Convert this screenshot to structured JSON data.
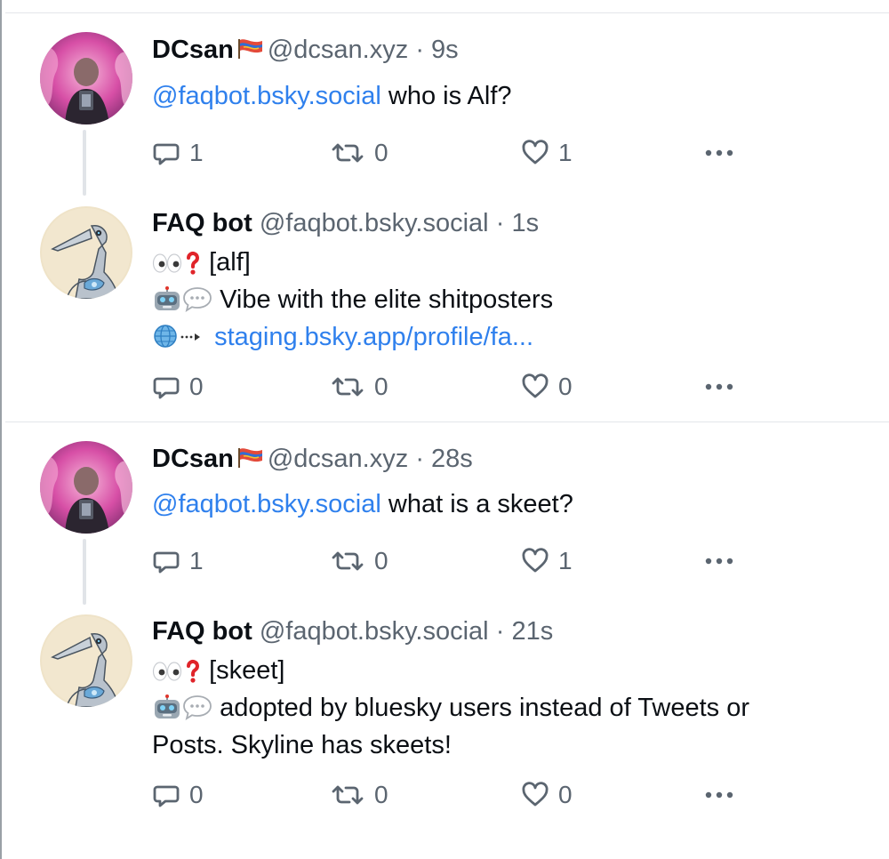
{
  "colors": {
    "link": "#2f80ed",
    "muted": "#5b6570",
    "divider": "#e3e6ea"
  },
  "posts": [
    {
      "name": "DCsan",
      "flag_icon": "flag-emoji-icon",
      "handle": "@dcsan.xyz",
      "separator": "·",
      "time": "9s",
      "mention": "@faqbot.bsky.social",
      "text": "who is Alf?",
      "replies": "1",
      "reposts": "0",
      "likes": "1"
    },
    {
      "name": "FAQ bot",
      "handle": "@faqbot.bsky.social",
      "separator": "·",
      "time": "1s",
      "line1": "[alf]",
      "line2": "Vibe with the elite shitposters",
      "link": "staging.bsky.app/profile/fa...",
      "replies": "0",
      "reposts": "0",
      "likes": "0"
    },
    {
      "name": "DCsan",
      "flag_icon": "flag-emoji-icon",
      "handle": "@dcsan.xyz",
      "separator": "·",
      "time": "28s",
      "mention": "@faqbot.bsky.social",
      "text": "what is a skeet?",
      "replies": "1",
      "reposts": "0",
      "likes": "1"
    },
    {
      "name": "FAQ bot",
      "handle": "@faqbot.bsky.social",
      "separator": "·",
      "time": "21s",
      "line1": "[skeet]",
      "line2a": "adopted by bluesky users instead of Tweets or",
      "line2b": "Posts. Skyline has skeets!",
      "replies": "0",
      "reposts": "0",
      "likes": "0"
    }
  ]
}
